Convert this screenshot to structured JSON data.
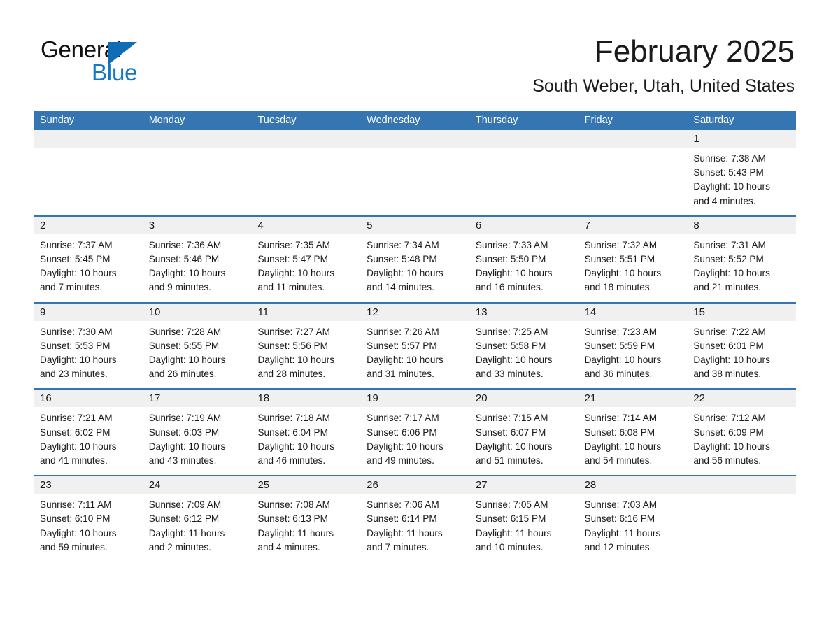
{
  "brand": {
    "name_part1": "General",
    "name_part2": "Blue",
    "accent_color": "#1477c4",
    "triangle_color": "#0f6cb5"
  },
  "header": {
    "title": "February 2025",
    "subtitle": "South Weber, Utah, United States"
  },
  "theme": {
    "header_blue": "#3575b2",
    "day_band_gray": "#f0f0f0",
    "cell_white": "#ffffff",
    "text_color": "#1a1a1a"
  },
  "weekdays": [
    "Sunday",
    "Monday",
    "Tuesday",
    "Wednesday",
    "Thursday",
    "Friday",
    "Saturday"
  ],
  "weeks": [
    {
      "days": [
        {
          "date": "",
          "empty": true
        },
        {
          "date": "",
          "empty": true
        },
        {
          "date": "",
          "empty": true
        },
        {
          "date": "",
          "empty": true
        },
        {
          "date": "",
          "empty": true
        },
        {
          "date": "",
          "empty": true
        },
        {
          "date": "1",
          "sunrise": "Sunrise: 7:38 AM",
          "sunset": "Sunset: 5:43 PM",
          "daylight_line1": "Daylight: 10 hours",
          "daylight_line2": "and 4 minutes."
        }
      ]
    },
    {
      "days": [
        {
          "date": "2",
          "sunrise": "Sunrise: 7:37 AM",
          "sunset": "Sunset: 5:45 PM",
          "daylight_line1": "Daylight: 10 hours",
          "daylight_line2": "and 7 minutes."
        },
        {
          "date": "3",
          "sunrise": "Sunrise: 7:36 AM",
          "sunset": "Sunset: 5:46 PM",
          "daylight_line1": "Daylight: 10 hours",
          "daylight_line2": "and 9 minutes."
        },
        {
          "date": "4",
          "sunrise": "Sunrise: 7:35 AM",
          "sunset": "Sunset: 5:47 PM",
          "daylight_line1": "Daylight: 10 hours",
          "daylight_line2": "and 11 minutes."
        },
        {
          "date": "5",
          "sunrise": "Sunrise: 7:34 AM",
          "sunset": "Sunset: 5:48 PM",
          "daylight_line1": "Daylight: 10 hours",
          "daylight_line2": "and 14 minutes."
        },
        {
          "date": "6",
          "sunrise": "Sunrise: 7:33 AM",
          "sunset": "Sunset: 5:50 PM",
          "daylight_line1": "Daylight: 10 hours",
          "daylight_line2": "and 16 minutes."
        },
        {
          "date": "7",
          "sunrise": "Sunrise: 7:32 AM",
          "sunset": "Sunset: 5:51 PM",
          "daylight_line1": "Daylight: 10 hours",
          "daylight_line2": "and 18 minutes."
        },
        {
          "date": "8",
          "sunrise": "Sunrise: 7:31 AM",
          "sunset": "Sunset: 5:52 PM",
          "daylight_line1": "Daylight: 10 hours",
          "daylight_line2": "and 21 minutes."
        }
      ]
    },
    {
      "days": [
        {
          "date": "9",
          "sunrise": "Sunrise: 7:30 AM",
          "sunset": "Sunset: 5:53 PM",
          "daylight_line1": "Daylight: 10 hours",
          "daylight_line2": "and 23 minutes."
        },
        {
          "date": "10",
          "sunrise": "Sunrise: 7:28 AM",
          "sunset": "Sunset: 5:55 PM",
          "daylight_line1": "Daylight: 10 hours",
          "daylight_line2": "and 26 minutes."
        },
        {
          "date": "11",
          "sunrise": "Sunrise: 7:27 AM",
          "sunset": "Sunset: 5:56 PM",
          "daylight_line1": "Daylight: 10 hours",
          "daylight_line2": "and 28 minutes."
        },
        {
          "date": "12",
          "sunrise": "Sunrise: 7:26 AM",
          "sunset": "Sunset: 5:57 PM",
          "daylight_line1": "Daylight: 10 hours",
          "daylight_line2": "and 31 minutes."
        },
        {
          "date": "13",
          "sunrise": "Sunrise: 7:25 AM",
          "sunset": "Sunset: 5:58 PM",
          "daylight_line1": "Daylight: 10 hours",
          "daylight_line2": "and 33 minutes."
        },
        {
          "date": "14",
          "sunrise": "Sunrise: 7:23 AM",
          "sunset": "Sunset: 5:59 PM",
          "daylight_line1": "Daylight: 10 hours",
          "daylight_line2": "and 36 minutes."
        },
        {
          "date": "15",
          "sunrise": "Sunrise: 7:22 AM",
          "sunset": "Sunset: 6:01 PM",
          "daylight_line1": "Daylight: 10 hours",
          "daylight_line2": "and 38 minutes."
        }
      ]
    },
    {
      "days": [
        {
          "date": "16",
          "sunrise": "Sunrise: 7:21 AM",
          "sunset": "Sunset: 6:02 PM",
          "daylight_line1": "Daylight: 10 hours",
          "daylight_line2": "and 41 minutes."
        },
        {
          "date": "17",
          "sunrise": "Sunrise: 7:19 AM",
          "sunset": "Sunset: 6:03 PM",
          "daylight_line1": "Daylight: 10 hours",
          "daylight_line2": "and 43 minutes."
        },
        {
          "date": "18",
          "sunrise": "Sunrise: 7:18 AM",
          "sunset": "Sunset: 6:04 PM",
          "daylight_line1": "Daylight: 10 hours",
          "daylight_line2": "and 46 minutes."
        },
        {
          "date": "19",
          "sunrise": "Sunrise: 7:17 AM",
          "sunset": "Sunset: 6:06 PM",
          "daylight_line1": "Daylight: 10 hours",
          "daylight_line2": "and 49 minutes."
        },
        {
          "date": "20",
          "sunrise": "Sunrise: 7:15 AM",
          "sunset": "Sunset: 6:07 PM",
          "daylight_line1": "Daylight: 10 hours",
          "daylight_line2": "and 51 minutes."
        },
        {
          "date": "21",
          "sunrise": "Sunrise: 7:14 AM",
          "sunset": "Sunset: 6:08 PM",
          "daylight_line1": "Daylight: 10 hours",
          "daylight_line2": "and 54 minutes."
        },
        {
          "date": "22",
          "sunrise": "Sunrise: 7:12 AM",
          "sunset": "Sunset: 6:09 PM",
          "daylight_line1": "Daylight: 10 hours",
          "daylight_line2": "and 56 minutes."
        }
      ]
    },
    {
      "days": [
        {
          "date": "23",
          "sunrise": "Sunrise: 7:11 AM",
          "sunset": "Sunset: 6:10 PM",
          "daylight_line1": "Daylight: 10 hours",
          "daylight_line2": "and 59 minutes."
        },
        {
          "date": "24",
          "sunrise": "Sunrise: 7:09 AM",
          "sunset": "Sunset: 6:12 PM",
          "daylight_line1": "Daylight: 11 hours",
          "daylight_line2": "and 2 minutes."
        },
        {
          "date": "25",
          "sunrise": "Sunrise: 7:08 AM",
          "sunset": "Sunset: 6:13 PM",
          "daylight_line1": "Daylight: 11 hours",
          "daylight_line2": "and 4 minutes."
        },
        {
          "date": "26",
          "sunrise": "Sunrise: 7:06 AM",
          "sunset": "Sunset: 6:14 PM",
          "daylight_line1": "Daylight: 11 hours",
          "daylight_line2": "and 7 minutes."
        },
        {
          "date": "27",
          "sunrise": "Sunrise: 7:05 AM",
          "sunset": "Sunset: 6:15 PM",
          "daylight_line1": "Daylight: 11 hours",
          "daylight_line2": "and 10 minutes."
        },
        {
          "date": "28",
          "sunrise": "Sunrise: 7:03 AM",
          "sunset": "Sunset: 6:16 PM",
          "daylight_line1": "Daylight: 11 hours",
          "daylight_line2": "and 12 minutes."
        },
        {
          "date": "",
          "empty": true
        }
      ]
    }
  ]
}
